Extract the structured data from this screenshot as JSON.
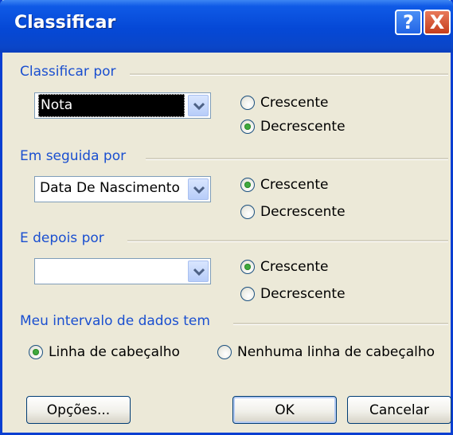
{
  "window": {
    "title": "Classificar",
    "help_icon": "?",
    "close_icon": "X"
  },
  "sort_by": {
    "label": "Classificar por",
    "value": "Nota",
    "ascending": "Crescente",
    "descending": "Decrescente",
    "selected": "descending"
  },
  "then_by": {
    "label": "Em seguida por",
    "value": "Data De Nascimento",
    "ascending": "Crescente",
    "descending": "Decrescente",
    "selected": "ascending"
  },
  "then_by_2": {
    "label": "E depois por",
    "value": "",
    "ascending": "Crescente",
    "descending": "Decrescente",
    "selected": "ascending"
  },
  "header": {
    "label": "Meu intervalo de dados tem",
    "has_header": "Linha de cabeçalho",
    "no_header": "Nenhuma linha de cabeçalho",
    "selected": "has_header"
  },
  "buttons": {
    "options": "Opções...",
    "ok": "OK",
    "cancel": "Cancelar"
  },
  "colors": {
    "titlebar": "#0548d6",
    "group_label": "#1a4fd0",
    "dialog_bg": "#ece9d8",
    "radio_checked": "#3fa93d"
  }
}
